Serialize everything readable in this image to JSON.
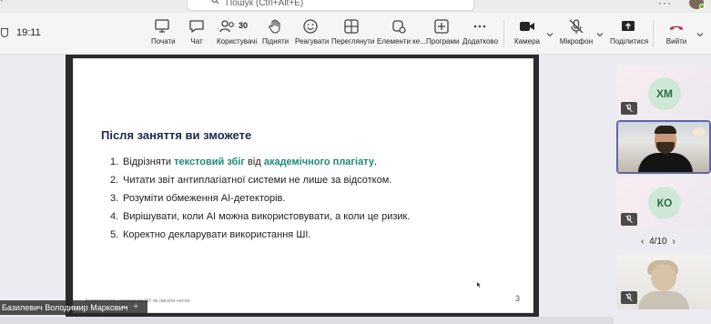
{
  "search": {
    "placeholder": "Пошук (Ctrl+Alt+E)"
  },
  "meeting": {
    "timer": "19:11"
  },
  "toolbar": {
    "chat": "Чат",
    "people_label": "Користувачі",
    "people_count": "30",
    "raise_hand": "Підняти",
    "react": "Реагувати",
    "view": "Переглянути",
    "stage_elements": "Елементи ке...",
    "apps": "Програми",
    "more": "Додатково",
    "camera": "Камера",
    "microphone": "Мікрофон",
    "share": "Поділитися",
    "leave": "Вийти",
    "start": "Почати"
  },
  "slide": {
    "title": "Після заняття ви зможете",
    "items": [
      {
        "num": "1.",
        "pre": "Відрізняти ",
        "hl1": "текстовий збіг",
        "mid": " від ",
        "hl2": "академічного плагіату",
        "post": "."
      },
      {
        "num": "2.",
        "text": "Читати звіт антиплагіатної системи не лише за відсотком."
      },
      {
        "num": "3.",
        "text": "Розуміти обмеження AI-детекторів."
      },
      {
        "num": "4.",
        "text": "Вирішувати, коли AI можна використовувати, а коли це ризик."
      },
      {
        "num": "5.",
        "text": "Коректно декларувати використання ШІ."
      }
    ],
    "footer": "Антиплагіатні системи та ШІ: як писати чесно",
    "page_number": "3"
  },
  "presenter": {
    "name": "Базилевич Володимир Маркович"
  },
  "participants": {
    "tiles": [
      {
        "initials": "ХМ"
      },
      {
        "initials": ""
      },
      {
        "initials": "КО"
      },
      {
        "initials": ""
      }
    ],
    "pager": "4/10"
  },
  "colors": {
    "accent": "#6264a7",
    "leave_red": "#c4314b",
    "slide_highlight": "#1a8a7b",
    "slide_title": "#1b2a4e"
  }
}
